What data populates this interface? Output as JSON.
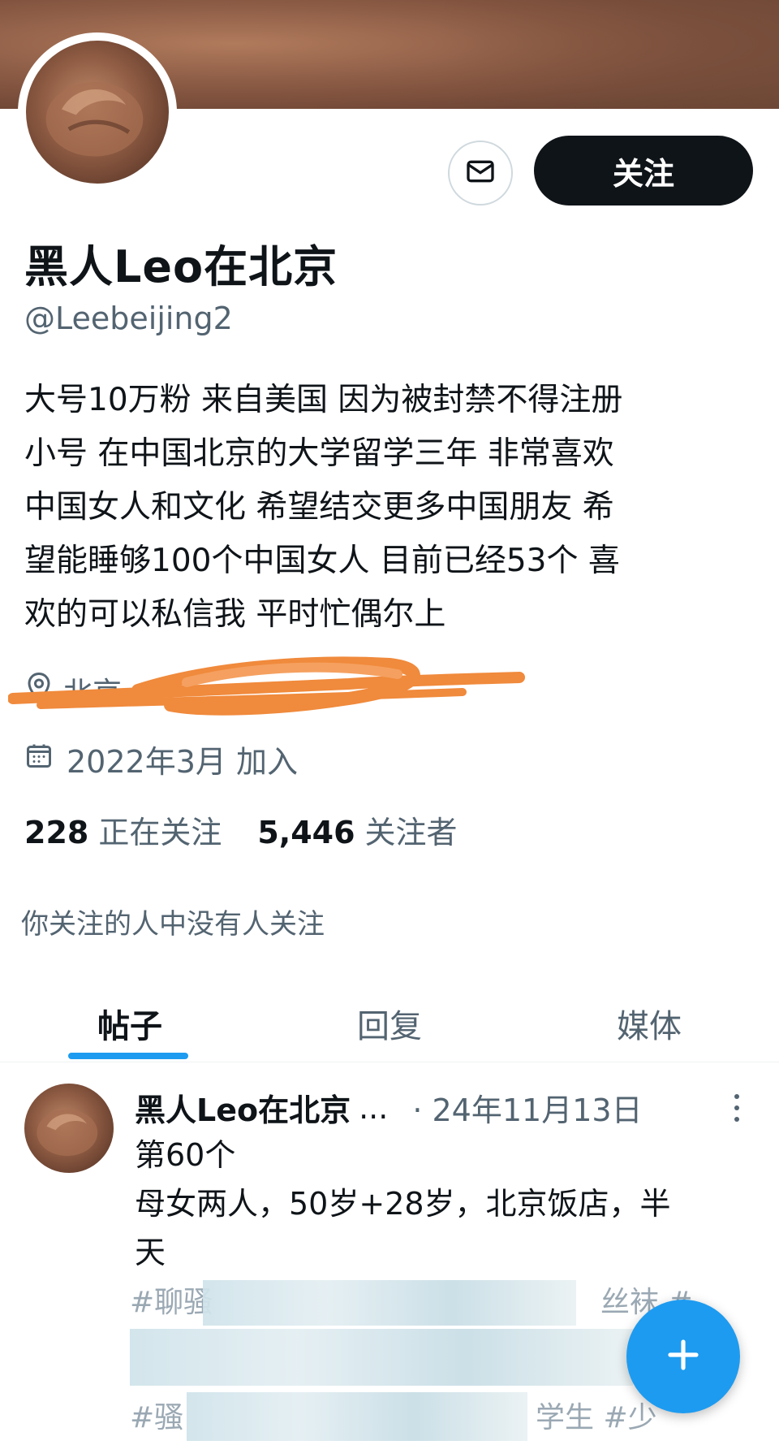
{
  "profile": {
    "follow_label": "关注",
    "display_name": "黑人Leo在北京",
    "handle": "@Leebeijing2",
    "bio_lines": [
      "大号10万粉 来自美国 因为被封禁不得注册",
      "小号 在中国北京的大学留学三年 非常喜欢",
      "中国女人和文化 希望结交更多中国朋友 希",
      "望能睡够100个中国女人 目前已经53个 喜",
      "欢的可以私信我 平时忙偶尔上"
    ],
    "location_visible": "北京",
    "joined": "2022年3月 加入",
    "following_count": "228",
    "following_label": "正在关注",
    "followers_count": "5,446",
    "followers_label": "关注者",
    "followed_by_note": "你关注的人中没有人关注"
  },
  "tabs": [
    {
      "label": "帖子",
      "active": true
    },
    {
      "label": "回复",
      "active": false
    },
    {
      "label": "媒体",
      "active": false
    }
  ],
  "post": {
    "author": "黑人Leo在北京",
    "ellipsis": "...",
    "date": "· 24年11月13日",
    "lines": [
      "第60个",
      "母女两人，50岁+28岁，北京饭店，半",
      "天"
    ],
    "tag_fragments": [
      "#聊骚",
      "丝袜 #",
      "#骚",
      "学生 #少"
    ]
  },
  "icons": {
    "message": "mail-icon",
    "location": "location-pin-icon",
    "calendar": "calendar-icon",
    "more": "more-vertical-icon",
    "compose": "plus-icon"
  },
  "colors": {
    "accent": "#1d9bf0",
    "text_primary": "#0f1419",
    "text_secondary": "#536471",
    "scribble": "#f08a3c"
  }
}
